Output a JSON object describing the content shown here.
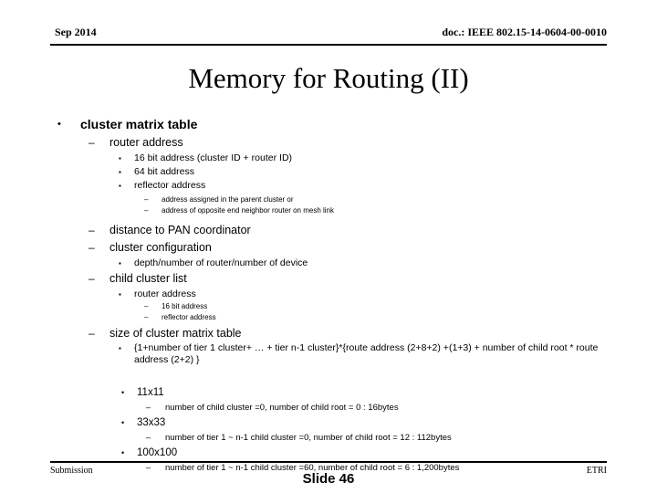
{
  "header": {
    "left": "Sep 2014",
    "right": "doc.: IEEE 802.15-14-0604-00-0010"
  },
  "title": "Memory for Routing (II)",
  "bullets": {
    "b1": "cluster matrix table",
    "b2": "router address",
    "b3": "16 bit address (cluster ID + router ID)",
    "b4": "64 bit address",
    "b5": "reflector address",
    "b6": "address assigned in the parent cluster or",
    "b7": "address of opposite end neighbor router on mesh link",
    "b8": "distance to PAN coordinator",
    "b9": "cluster configuration",
    "b10": "depth/number of router/number of device",
    "b11": "child cluster list",
    "b12": "router address",
    "b13": "16 bit address",
    "b14": "reflector address",
    "b15": "size of cluster matrix table",
    "b16": "{1+number of  tier 1 cluster+ …  + tier n-1  cluster}*{route address (2+8+2) +(1+3) + number of child root * route address (2+2) }",
    "b17": "11x11",
    "b18": "number of child cluster =0, number of child root = 0 : 16bytes",
    "b19": "33x33",
    "b20": "number of tier 1 ~ n-1 child cluster =0, number of child root = 12 : 112bytes",
    "b21": "100x100",
    "b22": "number of tier 1 ~ n-1 child cluster =60, number of child root = 6 : 1,200bytes"
  },
  "glyphs": {
    "round": "•",
    "dash": "–",
    "square": "▪"
  },
  "footer": {
    "left": "Submission",
    "center": "Slide 46",
    "right": "ETRI"
  }
}
